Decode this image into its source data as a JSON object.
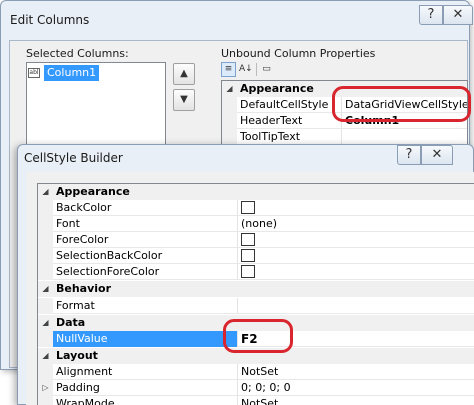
{
  "edit_columns": {
    "title": "Edit Columns",
    "help_glyph": "?",
    "close_glyph": "✕",
    "selected_columns_label": "Selected Columns:",
    "columns": [
      {
        "icon": "abl",
        "name": "Column1"
      }
    ],
    "move_up_glyph": "▲",
    "move_down_glyph": "▼",
    "properties_label": "Unbound Column Properties",
    "toolbar": {
      "categorized_glyph": "≡",
      "alphabetical_glyph": "A↓",
      "property_pages_glyph": "▭"
    },
    "grid": {
      "category": "Appearance",
      "rows": [
        {
          "name": "DefaultCellStyle",
          "value": "DataGridViewCellStyle { }"
        },
        {
          "name": "HeaderText",
          "value": "Column1"
        },
        {
          "name": "ToolTipText",
          "value": ""
        }
      ]
    }
  },
  "cellstyle_builder": {
    "title": "CellStyle Builder",
    "help_glyph": "?",
    "close_glyph": "✕",
    "collapse_glyph": "◢",
    "expand_glyph": "▷",
    "appearance": {
      "label": "Appearance",
      "rows": [
        {
          "name": "BackColor",
          "value": ""
        },
        {
          "name": "Font",
          "value": "(none)"
        },
        {
          "name": "ForeColor",
          "value": ""
        },
        {
          "name": "SelectionBackColor",
          "value": ""
        },
        {
          "name": "SelectionForeColor",
          "value": ""
        }
      ]
    },
    "behavior": {
      "label": "Behavior",
      "rows": [
        {
          "name": "Format",
          "value": ""
        }
      ]
    },
    "data": {
      "label": "Data",
      "rows": [
        {
          "name": "NullValue",
          "value": "F2"
        }
      ]
    },
    "layout": {
      "label": "Layout",
      "rows": [
        {
          "name": "Alignment",
          "value": "NotSet"
        },
        {
          "name": "Padding",
          "value": "0; 0; 0; 0"
        },
        {
          "name": "WrapMode",
          "value": "NotSet"
        }
      ]
    }
  },
  "colors": {
    "selection": "#3399ff",
    "annotation": "#d9262e"
  }
}
